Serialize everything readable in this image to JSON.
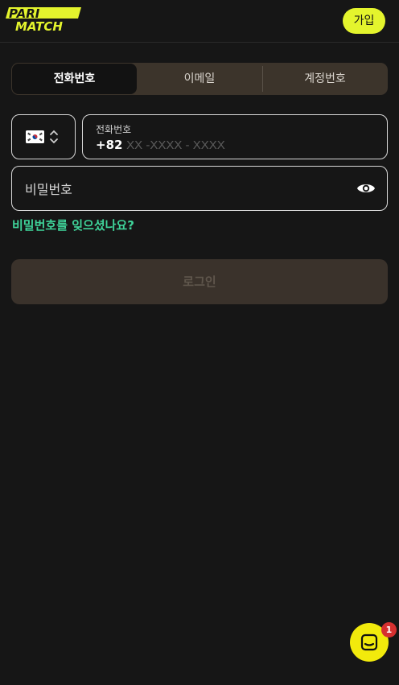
{
  "header": {
    "logo_text_top": "PARI",
    "logo_text_bottom": "MATCH",
    "signup_label": "가입"
  },
  "tabs": [
    {
      "label": "전화번호",
      "active": true
    },
    {
      "label": "이메일",
      "active": false
    },
    {
      "label": "계정번호",
      "active": false
    }
  ],
  "country": {
    "flag_icon": "south-korea-flag-icon",
    "chevron_icon": "chevron-up-down-icon"
  },
  "phone": {
    "label": "전화번호",
    "country_code": "+82",
    "placeholder": " XX -XXXX - XXXX",
    "value": ""
  },
  "password": {
    "placeholder": "비밀번호",
    "value": "",
    "toggle_icon": "eye-icon"
  },
  "forgot_password": "비밀번호를 잊으셨나요?",
  "login_label": "로그인",
  "chat": {
    "icon": "chat-icon",
    "badge_count": "1"
  },
  "colors": {
    "background": "#161616",
    "brand_yellow": "#e4f42d",
    "accent_green": "#3fd49a",
    "tab_bg": "#3c342b",
    "badge_red": "#d63030"
  }
}
